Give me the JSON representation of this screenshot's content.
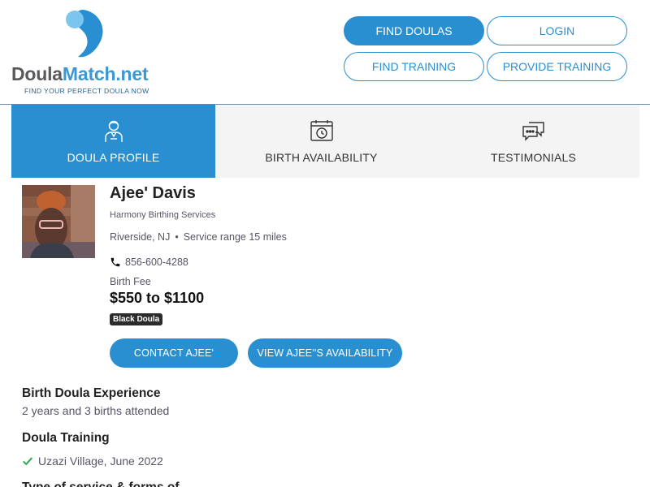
{
  "header": {
    "logo_name_a": "Doula",
    "logo_name_b": "Match.net",
    "tagline": "FIND YOUR PERFECT DOULA NOW",
    "nav": {
      "find_doulas": "FIND DOULAS",
      "login": "LOGIN",
      "find_training": "FIND TRAINING",
      "provide_training": "PROVIDE TRAINING"
    }
  },
  "tabs": [
    {
      "label": "DOULA PROFILE",
      "icon": "person-icon",
      "active": true
    },
    {
      "label": "BIRTH AVAILABILITY",
      "icon": "calendar-clock-icon",
      "active": false
    },
    {
      "label": "TESTIMONIALS",
      "icon": "chat-bubbles-icon",
      "active": false
    }
  ],
  "profile": {
    "name": "Ajee' Davis",
    "agency": "Harmony Birthing Services",
    "location": "Riverside, NJ",
    "separator": "•",
    "service_range": "Service range 15 miles",
    "phone": "856-600-4288",
    "fee_label": "Birth Fee",
    "fee": "$550 to $1100",
    "badge": "Black Doula",
    "contact_button": "CONTACT AJEE'",
    "availability_button": "VIEW AJEE''S AVAILABILITY"
  },
  "sections": {
    "experience_title": "Birth Doula Experience",
    "experience_text": "2 years and 3 births attended",
    "training_title": "Doula Training",
    "training_item": "Uzazi Village, June 2022",
    "next_title": "Type of service & forms of"
  },
  "colors": {
    "accent": "#2a8fd0",
    "tab_bg": "#f4f4f4",
    "badge_bg": "#2b2b2b",
    "check": "#2aa84a"
  }
}
